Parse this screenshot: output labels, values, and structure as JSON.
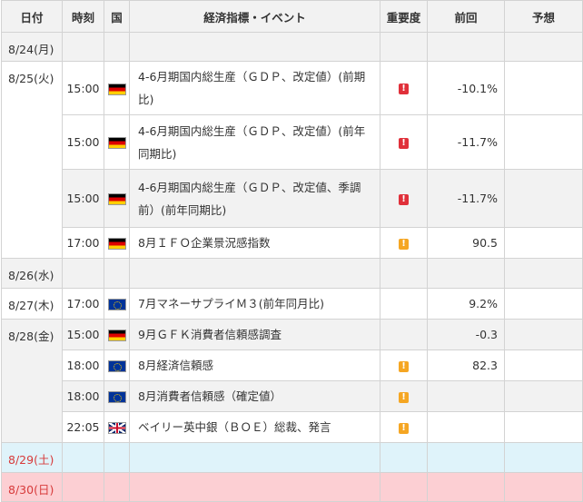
{
  "headers": {
    "date": "日付",
    "time": "時刻",
    "country": "国",
    "event": "経済指標・イベント",
    "importance": "重要度",
    "previous": "前回",
    "forecast": "予想"
  },
  "colors": {
    "header_bg": "#f2f2f2",
    "alt_row_bg": "#f2f2f2",
    "saturday_bg": "#dff3fa",
    "sunday_bg": "#fccfd3",
    "weekend_text": "#d73a3a",
    "importance_high": "#e0303a",
    "importance_mid": "#f5a623"
  },
  "importance_glyph": "!",
  "rows": [
    {
      "date": "8/24(月)",
      "time": "",
      "flag": "",
      "event": "",
      "importance": "",
      "previous": "",
      "forecast": ""
    },
    {
      "date": "8/25(火)",
      "time": "15:00",
      "flag": "germany-flag",
      "event": "4-6月期国内総生産（ＧＤＰ、改定値）(前期比)",
      "importance": "high",
      "previous": "-10.1%",
      "forecast": ""
    },
    {
      "date": "",
      "time": "15:00",
      "flag": "germany-flag",
      "event": "4-6月期国内総生産（ＧＤＰ、改定値）(前年同期比)",
      "importance": "high",
      "previous": "-11.7%",
      "forecast": ""
    },
    {
      "date": "",
      "time": "15:00",
      "flag": "germany-flag",
      "event": "4-6月期国内総生産（ＧＤＰ、改定値、季調前）(前年同期比)",
      "importance": "high",
      "previous": "-11.7%",
      "forecast": ""
    },
    {
      "date": "",
      "time": "17:00",
      "flag": "germany-flag",
      "event": "8月ＩＦＯ企業景況感指数",
      "importance": "mid",
      "previous": "90.5",
      "forecast": ""
    },
    {
      "date": "8/26(水)",
      "time": "",
      "flag": "",
      "event": "",
      "importance": "",
      "previous": "",
      "forecast": ""
    },
    {
      "date": "8/27(木)",
      "time": "17:00",
      "flag": "eu-flag",
      "event": "7月マネーサプライＭ３(前年同月比)",
      "importance": "",
      "previous": "9.2%",
      "forecast": ""
    },
    {
      "date": "8/28(金)",
      "time": "15:00",
      "flag": "germany-flag",
      "event": "9月ＧＦＫ消費者信頼感調査",
      "importance": "",
      "previous": "-0.3",
      "forecast": ""
    },
    {
      "date": "",
      "time": "18:00",
      "flag": "eu-flag",
      "event": "8月経済信頼感",
      "importance": "mid",
      "previous": "82.3",
      "forecast": ""
    },
    {
      "date": "",
      "time": "18:00",
      "flag": "eu-flag",
      "event": "8月消費者信頼感（確定値）",
      "importance": "mid",
      "previous": "",
      "forecast": ""
    },
    {
      "date": "",
      "time": "22:05",
      "flag": "uk-flag",
      "event": "ベイリー英中銀（ＢＯＥ）総裁、発言",
      "importance": "mid",
      "previous": "",
      "forecast": ""
    },
    {
      "date": "8/29(土)",
      "time": "",
      "flag": "",
      "event": "",
      "importance": "",
      "previous": "",
      "forecast": ""
    },
    {
      "date": "8/30(日)",
      "time": "",
      "flag": "",
      "event": "",
      "importance": "",
      "previous": "",
      "forecast": ""
    }
  ]
}
